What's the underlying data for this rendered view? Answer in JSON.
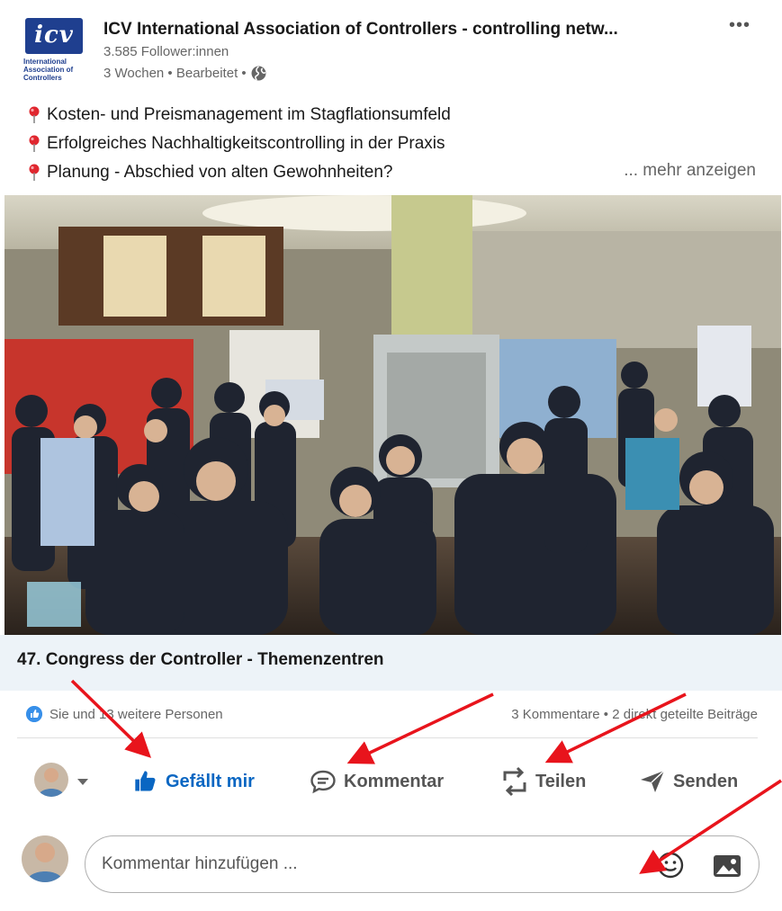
{
  "post": {
    "logo_text": "icv",
    "logo_caption": "International Association of Controllers",
    "org_name": "ICV International Association of Controllers - controlling netw...",
    "followers": "3.585 Follower:innen",
    "meta": "3 Wochen • Bearbeitet •",
    "more_menu": "•••",
    "lines": [
      "Kosten- und Preismanagement im Stagflationsumfeld",
      "Erfolgreiches Nachhaltigkeitscontrolling in der Praxis",
      "Planung - Abschied von alten Gewohnheiten?"
    ],
    "more_link": "... mehr anzeigen",
    "video_caption": "47. Congress der Controller - Themenzentren"
  },
  "social": {
    "reactions": "Sie und 13 weitere Personen",
    "stats": "3 Kommentare • 2 direkt geteilte Beiträge"
  },
  "actions": {
    "like": "Gefällt mir",
    "comment": "Kommentar",
    "share": "Teilen",
    "send": "Senden"
  },
  "comment": {
    "placeholder": "Kommentar hinzufügen ..."
  },
  "colors": {
    "accent": "#0a66c2",
    "annotation": "#e8141c",
    "caption_bg": "#edf3f8"
  },
  "icons": [
    "globe-icon",
    "pin-icon",
    "like-icon",
    "comment-icon",
    "share-icon",
    "send-icon",
    "emoji-icon",
    "image-icon",
    "caret-down-icon",
    "more-icon"
  ]
}
